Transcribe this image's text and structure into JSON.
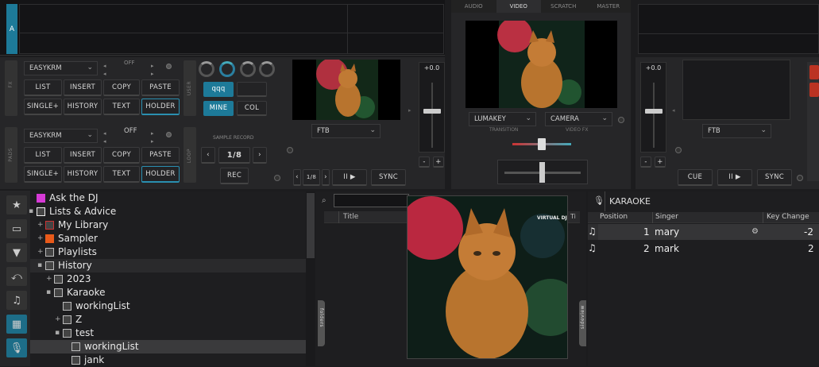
{
  "top_tabs": [
    "AUDIO",
    "VIDEO",
    "SCRATCH",
    "MASTER"
  ],
  "deck_a": {
    "label": "A",
    "effect_select": "EASYKRM",
    "off_label": "OFF",
    "pad_labels_row1": [
      "LIST",
      "INSERT",
      "COPY",
      "PASTE"
    ],
    "pad_labels_row2": [
      "SINGLE+",
      "HISTORY",
      "TEXT",
      "HOLDER"
    ],
    "pads_side_label": "FX",
    "user_label": "USER",
    "user_buttons": [
      "qqq",
      "",
      "MINE",
      "COL"
    ],
    "effect_select2": "EASYKRM",
    "off_label2": "OFF",
    "pads_side_label2": "PADS",
    "loop_label": "LOOP",
    "sample_record": "SAMPLE RECORD",
    "loop_value": "1/8",
    "rec": "REC",
    "video_select": "FTB",
    "pitch": "+0.0",
    "minus": "-",
    "plus": "+",
    "loop_small": "1/8",
    "play_icon": "II ▶",
    "sync": "SYNC"
  },
  "mixer": {
    "left_select": "LUMAKEY",
    "right_select": "CAMERA",
    "transition_label": "TRANSITION",
    "videofx_label": "VIDEO FX"
  },
  "deck_b": {
    "pitch": "+0.0",
    "video_select": "FTB",
    "cue": "CUE",
    "play_icon": "II ▶",
    "sync": "SYNC",
    "minus": "-",
    "plus": "+"
  },
  "browser": {
    "tree": [
      {
        "label": "Ask the DJ",
        "indent": 0,
        "exp": ""
      },
      {
        "label": "Lists & Advice",
        "indent": 0,
        "exp": "-"
      },
      {
        "label": "My Library",
        "indent": 1,
        "exp": "+"
      },
      {
        "label": "Sampler",
        "indent": 1,
        "exp": "+"
      },
      {
        "label": "Playlists",
        "indent": 1,
        "exp": "+"
      },
      {
        "label": "History",
        "indent": 1,
        "exp": "-"
      },
      {
        "label": "2023",
        "indent": 2,
        "exp": "+"
      },
      {
        "label": "Karaoke",
        "indent": 2,
        "exp": "-"
      },
      {
        "label": "workingList",
        "indent": 3,
        "exp": ""
      },
      {
        "label": "Z",
        "indent": 3,
        "exp": "+"
      },
      {
        "label": "test",
        "indent": 3,
        "exp": "-"
      },
      {
        "label": "workingList",
        "indent": 4,
        "exp": ""
      },
      {
        "label": "jank",
        "indent": 4,
        "exp": ""
      }
    ],
    "column_title": "Title",
    "column_ti": "Ti",
    "folders_tab": "folders",
    "sideview_tab": "sideview",
    "watermark": "VIRTUAL DJ"
  },
  "karaoke": {
    "title": "KARAOKE",
    "columns": [
      "Position",
      "Singer",
      "Key Change"
    ],
    "rows": [
      {
        "position": "1",
        "singer": "mary",
        "key": "-2"
      },
      {
        "position": "2",
        "singer": "mark",
        "key": "2"
      }
    ]
  }
}
